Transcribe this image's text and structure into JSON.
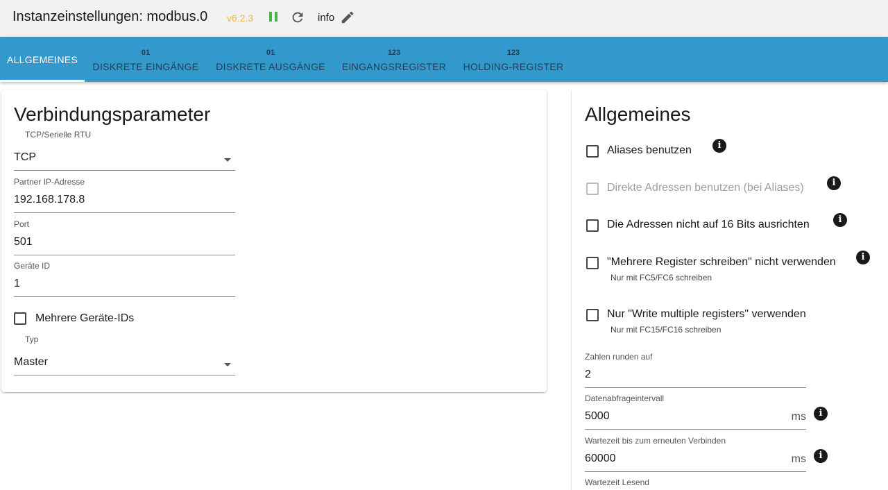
{
  "header": {
    "title": "Instanzeinstellungen: modbus.0",
    "version": "v6.2.3",
    "info_label": "info",
    "colors": {
      "version": "#f0b545",
      "pause": "#4caf50"
    }
  },
  "tabs": [
    {
      "label": "ALLGEMEINES",
      "icon_text": "",
      "active": true
    },
    {
      "label": "DISKRETE EINGÄNGE",
      "icon_text": "01",
      "active": false
    },
    {
      "label": "DISKRETE AUSGÄNGE",
      "icon_text": "01",
      "active": false
    },
    {
      "label": "EINGANGSREGISTER",
      "icon_text": "123",
      "active": false
    },
    {
      "label": "HOLDING-REGISTER",
      "icon_text": "123",
      "active": false
    }
  ],
  "connection": {
    "heading": "Verbindungsparameter",
    "type_label": "TCP/Serielle RTU",
    "type_value": "TCP",
    "ip_label": "Partner IP-Adresse",
    "ip_value": "192.168.178.8",
    "port_label": "Port",
    "port_value": "501",
    "device_label": "Geräte ID",
    "device_value": "1",
    "multi_devices_label": "Mehrere Geräte-IDs",
    "multi_devices_checked": false,
    "mode_label": "Typ",
    "mode_value": "Master"
  },
  "general": {
    "heading": "Allgemeines",
    "options": [
      {
        "label": "Aliases benutzen",
        "checked": false,
        "disabled": false,
        "help": ""
      },
      {
        "label": "Direkte Adressen benutzen (bei Aliases)",
        "checked": false,
        "disabled": true,
        "help": ""
      },
      {
        "label": "Die Adressen nicht auf 16 Bits ausrichten",
        "checked": false,
        "disabled": false,
        "help": ""
      },
      {
        "label": "\"Mehrere Register schreiben\" nicht verwenden",
        "checked": false,
        "disabled": false,
        "help": "Nur mit FC5/FC6 schreiben"
      },
      {
        "label": "Nur \"Write multiple registers\" verwenden",
        "checked": false,
        "disabled": false,
        "help": "Nur mit FC15/FC16 schreiben"
      }
    ],
    "round_label": "Zahlen runden auf",
    "round_value": "2",
    "poll_label": "Datenabfrageintervall",
    "poll_value": "5000",
    "poll_unit": "ms",
    "reconnect_label": "Wartezeit bis zum erneuten Verbinden",
    "reconnect_value": "60000",
    "reconnect_unit": "ms",
    "read_timeout_label": "Wartezeit Lesend"
  }
}
